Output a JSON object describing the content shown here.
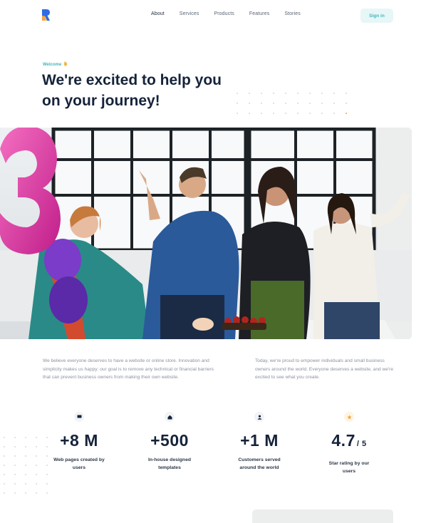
{
  "nav": {
    "items": [
      {
        "label": "About",
        "active": true
      },
      {
        "label": "Services",
        "active": false
      },
      {
        "label": "Products",
        "active": false
      },
      {
        "label": "Features",
        "active": false
      },
      {
        "label": "Stories",
        "active": false
      }
    ],
    "signin_label": "Sign in"
  },
  "hero": {
    "eyebrow": "Welcome",
    "eyebrow_icon": "waving-hand-icon",
    "headline": "We're excited to help you on your journey!"
  },
  "photo": {
    "balloon_digit": "3"
  },
  "about": {
    "paragraph_left": "We believe everyone deserves to have a website or online store. Innovation and simplicity makes us happy: our goal is to remove any technical or financial barriers that can prevent business owners from making their own website.",
    "paragraph_right": "Today, we're proud to empower individuals and small business owners around the world. Everyone deserves a website, and we're excited to see what you create."
  },
  "stats": [
    {
      "icon": "monitor-icon",
      "value": "+8 M",
      "suffix": "",
      "label": "Web pages created by users"
    },
    {
      "icon": "home-icon",
      "value": "+500",
      "suffix": "",
      "label": "In-house designed templates"
    },
    {
      "icon": "user-icon",
      "value": "+1 M",
      "suffix": "",
      "label": "Customers served around the world"
    },
    {
      "icon": "star-icon",
      "value": "4.7",
      "suffix": "/ 5",
      "label": "Star rating by our users"
    }
  ],
  "colors": {
    "accent": "#3fb7bd",
    "heading": "#15233a",
    "body_text": "#8a929d",
    "logo_blue": "#2f6be6",
    "logo_yellow": "#f7c533"
  }
}
